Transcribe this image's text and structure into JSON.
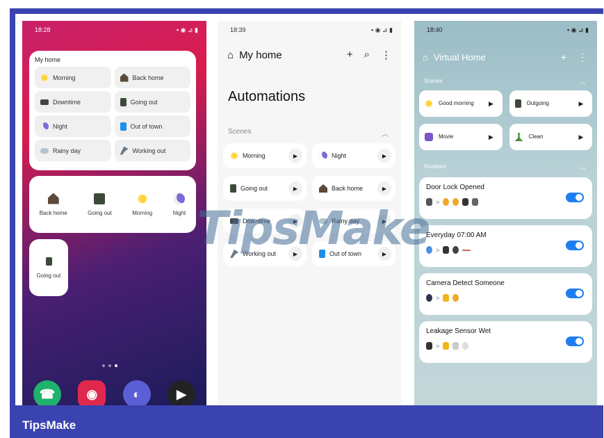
{
  "brand": "TipsMake",
  "watermark": "TipsMake",
  "phone1": {
    "time": "18:28",
    "status_icons": "▪ ◉ ⊿ ▮",
    "widget_title": "My home",
    "widget_items": [
      "Morning",
      "Back home",
      "Downtime",
      "Going out",
      "Night",
      "Out of town",
      "Rainy day",
      "Working out"
    ],
    "widget2_items": [
      "Back home",
      "Going out",
      "Morning",
      "Night"
    ],
    "widget3_label": "Going out"
  },
  "phone2": {
    "time": "18:39",
    "status_icons": "▪ ◉ ⊿ ▮",
    "title": "My home",
    "add_icon": "+",
    "search_icon": "⌕",
    "more_icon": "⋮",
    "heading": "Automations",
    "section": "Scenes",
    "collapse": "︿",
    "scenes": [
      "Morning",
      "Night",
      "Going out",
      "Back home",
      "Downtime",
      "Rainy day",
      "Working out",
      "Out of town"
    ]
  },
  "phone3": {
    "time": "18:40",
    "status_icons": "▪ ◉ ⊿ ▮",
    "title": "Virtual Home",
    "add_icon": "+",
    "more_icon": "⋮",
    "scenes_label": "Scenes",
    "routines_label": "Routines",
    "collapse": "︿",
    "scenes": [
      "Good morning",
      "Outgoing",
      "Movie",
      "Clean"
    ],
    "routines": [
      "Door Lock Opened",
      "Everyday 07:00 AM",
      "Camera Detect Someone",
      "Leakage Sensor Wet"
    ],
    "arrow": ">"
  },
  "colors": {
    "frame": "#3b43b1",
    "toggle": "#1f7df0"
  }
}
